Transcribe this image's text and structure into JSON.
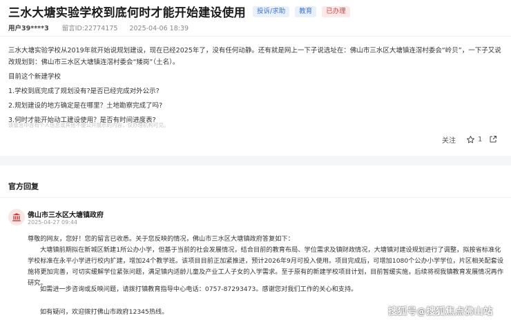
{
  "question": {
    "title": "三水大塘实验学校到底何时才能开始建设使用",
    "tags": [
      {
        "label": "投诉/求助",
        "color": "#3e72d4"
      },
      {
        "label": "教育",
        "color": "#3e72d4"
      },
      {
        "label": "已办理",
        "color": "#e04545"
      }
    ],
    "user": "用户39****3",
    "message_id": "留言ID:22774175",
    "date": "2025-04-06 18:39",
    "paragraphs": [
      "三水大塘实验学校从2019年就开始说规划建设，现在已经2025年了，没有任何动静。还有就是网上一下子说选址在：佛山市三水区大塘镇连滘村委会“岭贝”，一下子又说改规划到：佛山市三水区大塘镇连滘村委会“矮岗”（土名）。",
      "目前这个新建学校",
      "1.学校到底完成了规划没有?是否已经完成对外公示?",
      "2.规划建设的地方确定是在哪里？土地勘察完成了吗?",
      "3.何时才能开始动工建设使用？是否有时间进度表?"
    ],
    "notice": "该留言中含有个人信息或其他不便公开展示的内容，仅办理机构可见。",
    "actions": {
      "follow_label": "关注",
      "star_count": "1"
    }
  },
  "official_reply": {
    "heading": "官方回复",
    "org_name": "佛山市三水区大塘镇政府",
    "time": "2025-04-27 09:44",
    "greeting": "尊敬的网友，您好！您的留言已收悉。关于您反映的情况，佛山市三水区大塘镇政府答复如下：",
    "body": "大塘镇前期拟在新城区新建1所公办小学，但基于当前的社会发展情况，结合目前的教育布局、学位需求及镇财政情况，大塘镇对建设规划进行了调整，拟按省标准化学校标准在永平小学进行校内扩建，增加24个教学班。该项目目前正加紧推进，预计2026年9月可投入使用。项目完成后，可增加1080个公办小学学位，片区相关配套设施将更加完善，可切实缓解学位紧张问题，满足镇内适龄儿童及产业工人子女的入学需求。至于原有的新建学校项目计划，目前暂缓实施，后续将视我镇教育发展情况再作研究。",
    "contact": "如需进一步咨询或反映问题，请拨打镇教育指导中心电话：0757-87293473。感谢您对我们工作的关心和支持。",
    "hotline": "如有疑问，欢迎拨打佛山市政府12345热线。"
  },
  "watermark": "搜狐号@搜狐焦点佛山站",
  "icons": {
    "star": "star-outline-icon",
    "share": "share-icon",
    "org": "government-building-icon"
  },
  "colors": {
    "accent_blue": "#3e72d4",
    "accent_red": "#e04545"
  }
}
